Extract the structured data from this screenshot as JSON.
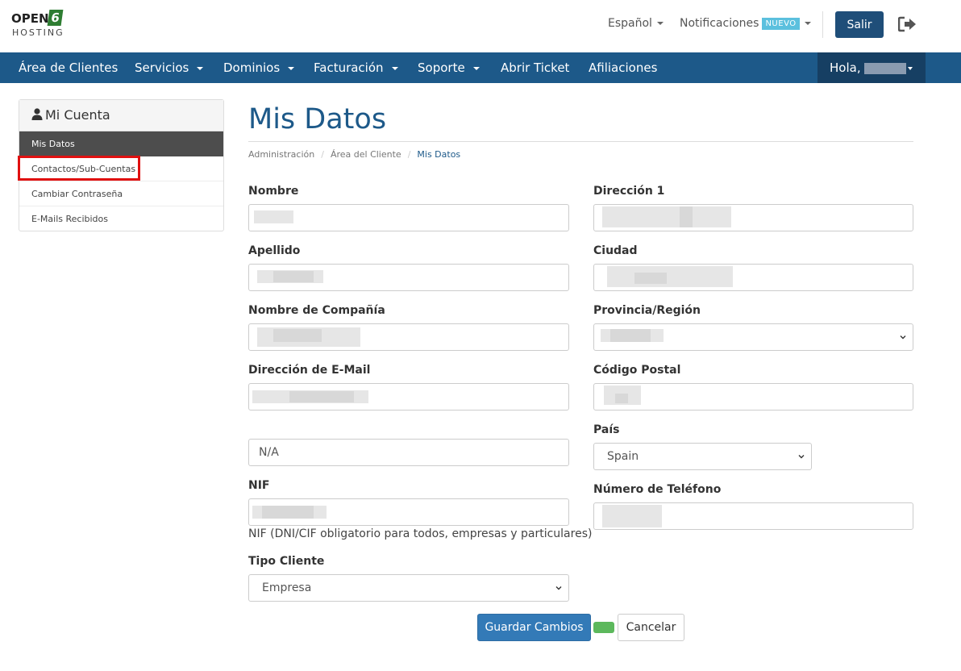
{
  "logo": {
    "word": "OPEN",
    "digit": "6",
    "sub": "HOSTING"
  },
  "topbar": {
    "language": "Español",
    "notifications": "Notificaciones",
    "badge": "NUEVO",
    "logout_button": "Salir",
    "logout_icon": "sign-out-icon"
  },
  "nav": {
    "items": [
      {
        "label": "Área de Clientes",
        "dropdown": false
      },
      {
        "label": "Servicios",
        "dropdown": true
      },
      {
        "label": "Dominios",
        "dropdown": true
      },
      {
        "label": "Facturación",
        "dropdown": true
      },
      {
        "label": "Soporte",
        "dropdown": true
      },
      {
        "label": "Abrir Ticket",
        "dropdown": false
      },
      {
        "label": "Afiliaciones",
        "dropdown": false
      }
    ],
    "greeting": "Hola,"
  },
  "sidebar": {
    "title": "Mi Cuenta",
    "title_icon": "user-icon",
    "items": [
      {
        "label": "Mis Datos",
        "active": true
      },
      {
        "label": "Contactos/Sub-Cuentas",
        "active": false,
        "highlighted": true
      },
      {
        "label": "Cambiar Contraseña",
        "active": false
      },
      {
        "label": "E-Mails Recibidos",
        "active": false
      }
    ]
  },
  "page": {
    "title": "Mis Datos",
    "breadcrumb": [
      "Administración",
      "Área del Cliente",
      "Mis Datos"
    ]
  },
  "form": {
    "nombre": "Nombre",
    "apellido": "Apellido",
    "compania": "Nombre de Compañía",
    "email": "Dirección de E-Mail",
    "extra_value": "N/A",
    "nif": "NIF",
    "nif_help": "NIF (DNI/CIF obligatorio para todos, empresas y particulares)",
    "tipo_cliente": "Tipo Cliente",
    "tipo_cliente_value": "Empresa",
    "direccion1": "Dirección 1",
    "ciudad": "Ciudad",
    "provincia": "Provincia/Región",
    "codigo_postal": "Código Postal",
    "pais": "País",
    "pais_value": "Spain",
    "telefono": "Número de Teléfono"
  },
  "actions": {
    "save": "Guardar Cambios",
    "cancel": "Cancelar"
  },
  "colors": {
    "brand_blue": "#1d5989",
    "nav_dark": "#163f63",
    "primary_button": "#337ab7",
    "highlight_red": "#e01010",
    "badge": "#5bc0de",
    "success": "#5cb85c"
  }
}
